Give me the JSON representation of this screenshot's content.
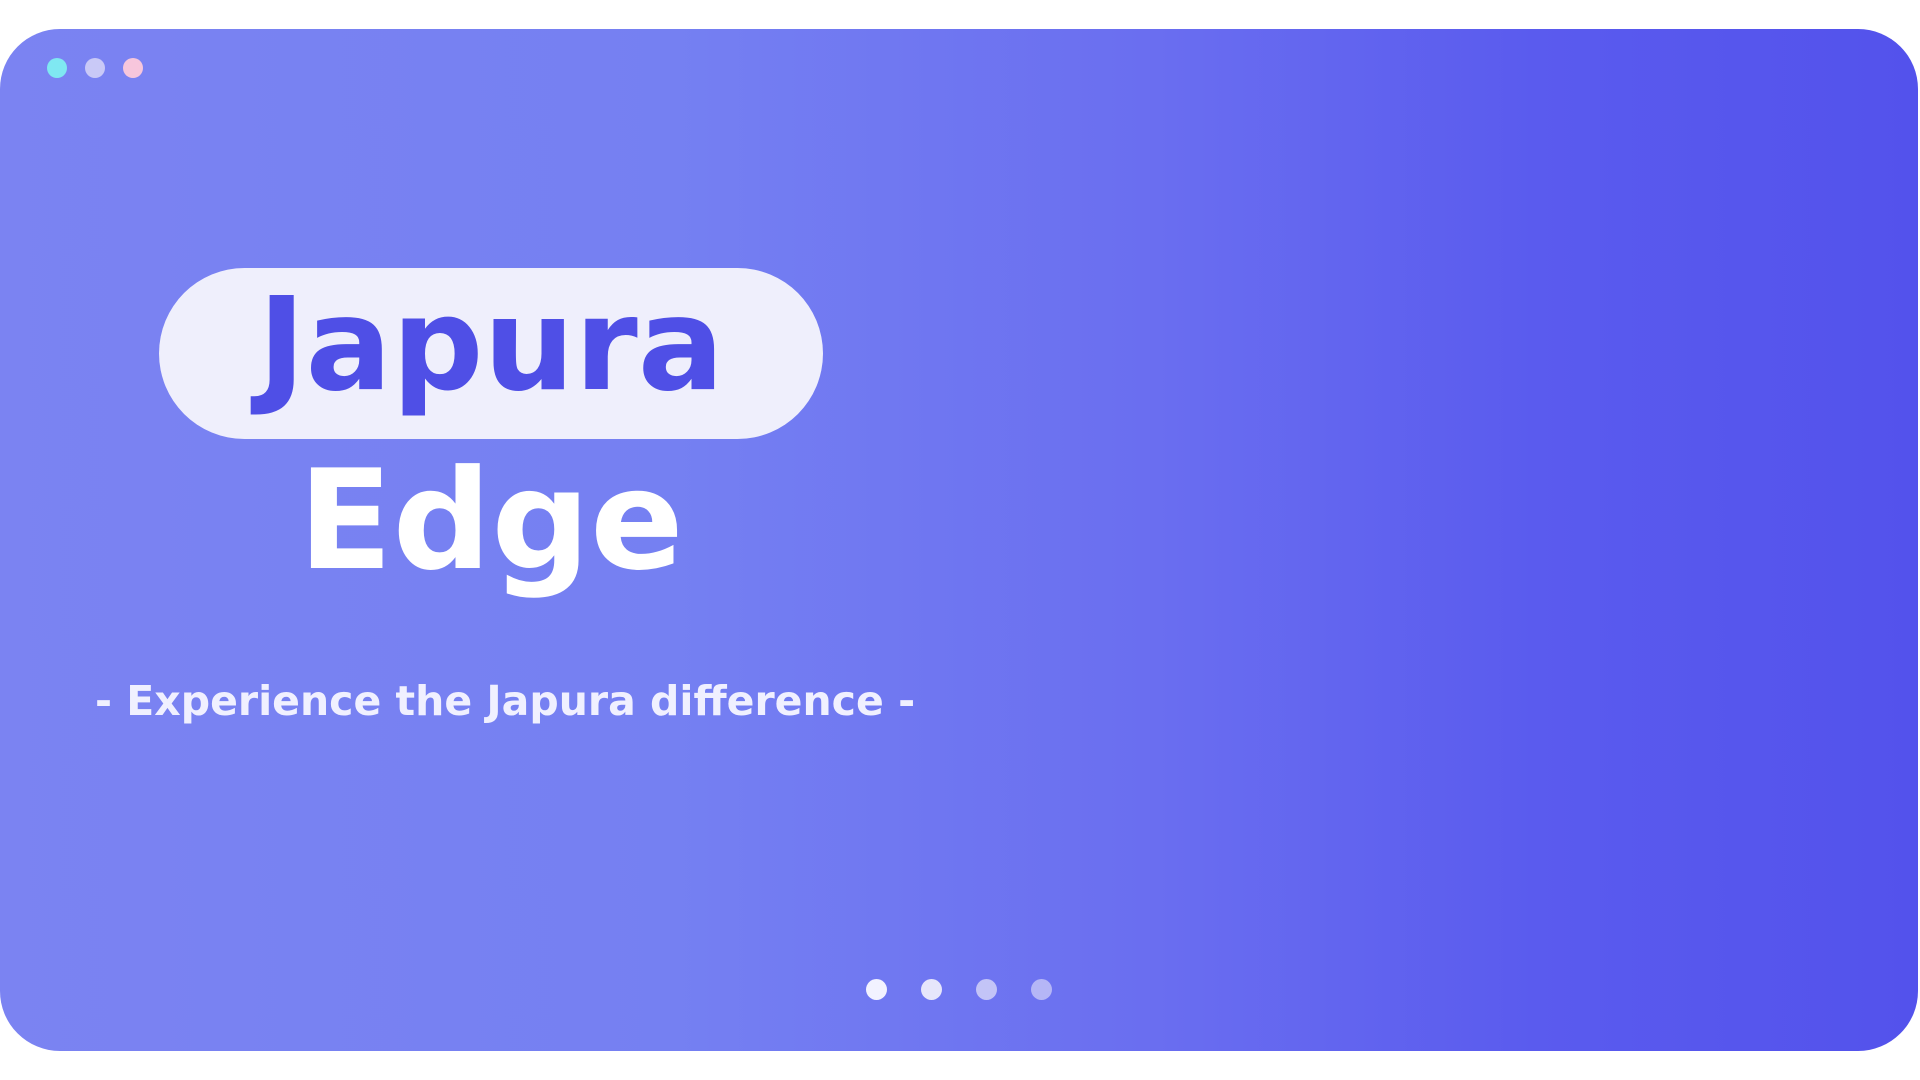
{
  "window_controls": {
    "colors": [
      "#7fe8f2",
      "#c9c9f7",
      "#f7c6dc"
    ]
  },
  "hero": {
    "title_line1": "Japura",
    "title_line2": "Edge",
    "tagline": "- Experience the Japura difference -"
  },
  "carousel": {
    "total_slides": 4,
    "active_index": 0,
    "active_color": "#f2f2ff",
    "inactive_colors": [
      "#e6e6fb",
      "#c3c4f7",
      "#b5b6f6"
    ]
  },
  "colors": {
    "accent": "#4f4fe6",
    "gradient_start": "#7b83f2",
    "gradient_end": "#5352ec",
    "pill_bg": "#efeffc"
  }
}
